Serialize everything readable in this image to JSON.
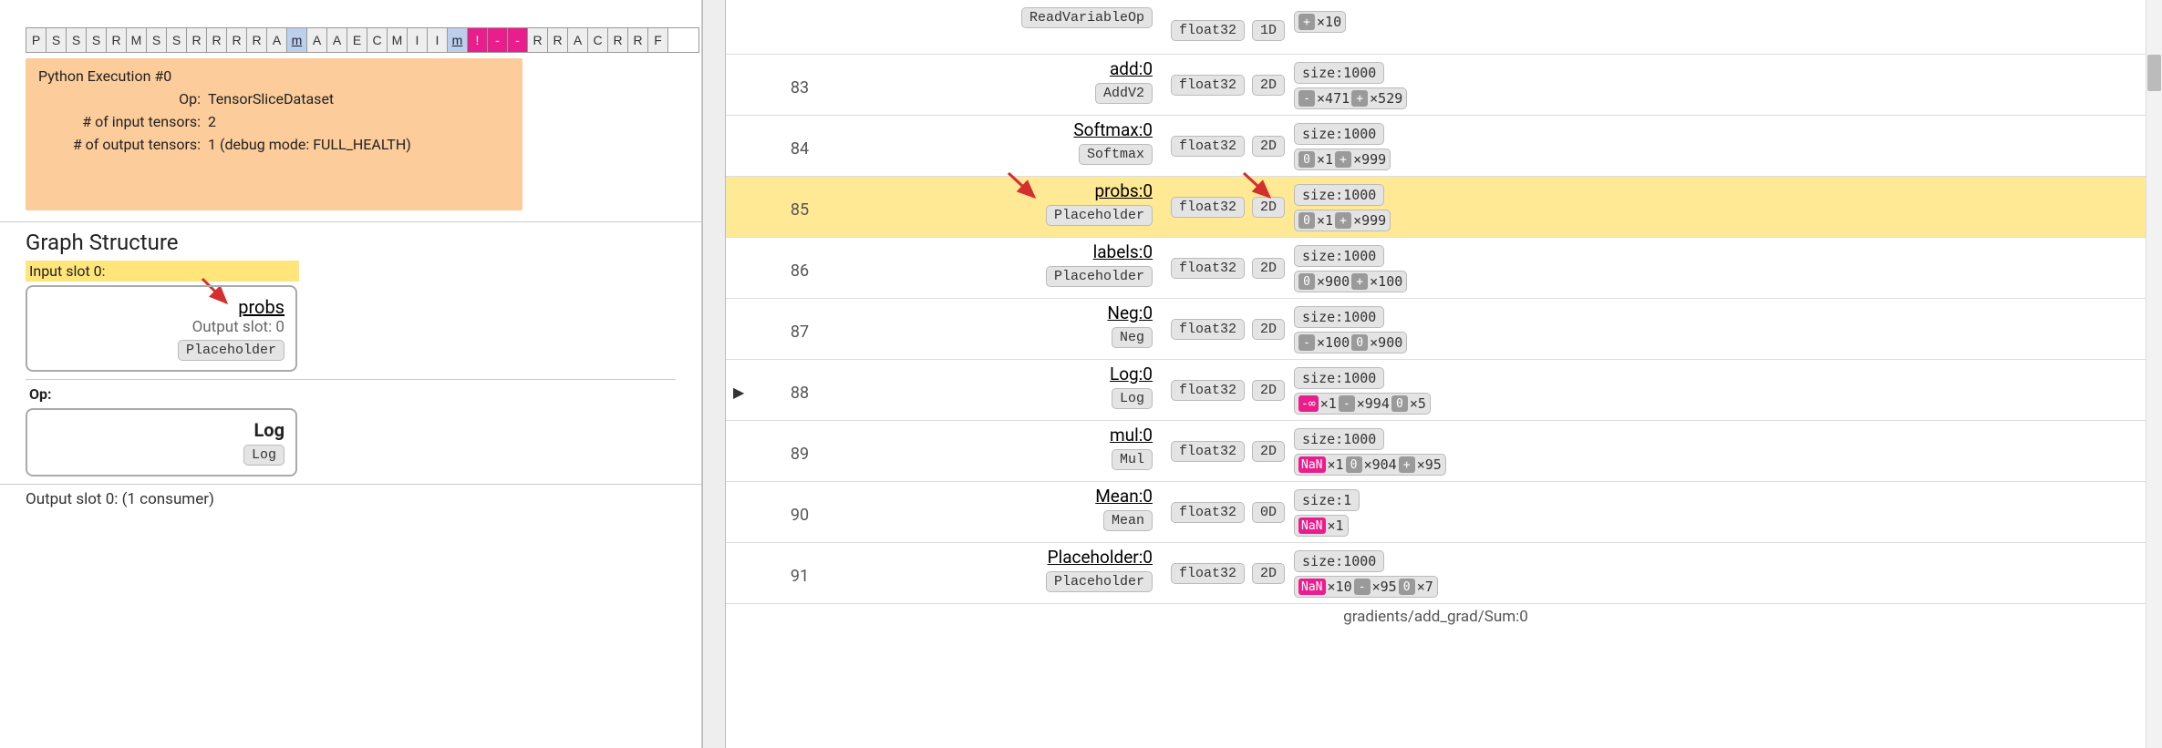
{
  "timeline": [
    {
      "l": "P"
    },
    {
      "l": "S"
    },
    {
      "l": "S"
    },
    {
      "l": "S"
    },
    {
      "l": "R"
    },
    {
      "l": "M"
    },
    {
      "l": "S"
    },
    {
      "l": "S"
    },
    {
      "l": "R"
    },
    {
      "l": "R"
    },
    {
      "l": "R"
    },
    {
      "l": "R"
    },
    {
      "l": "A"
    },
    {
      "l": "m",
      "cls": "bluebox",
      "link": true
    },
    {
      "l": "A"
    },
    {
      "l": "A"
    },
    {
      "l": "E"
    },
    {
      "l": "C"
    },
    {
      "l": "M"
    },
    {
      "l": "I"
    },
    {
      "l": "I"
    },
    {
      "l": "m",
      "cls": "bluebox",
      "link": true
    },
    {
      "l": "!",
      "cls": "magenta"
    },
    {
      "l": "-",
      "cls": "magenta"
    },
    {
      "l": "-",
      "cls": "magenta"
    },
    {
      "l": "R"
    },
    {
      "l": "R"
    },
    {
      "l": "A"
    },
    {
      "l": "C"
    },
    {
      "l": "R"
    },
    {
      "l": "R"
    },
    {
      "l": "F"
    }
  ],
  "detail": {
    "title": "Python Execution #0",
    "rows": [
      {
        "label": "Op:",
        "val": "TensorSliceDataset"
      },
      {
        "label": "# of input tensors:",
        "val": "2"
      },
      {
        "label": "# of output tensors:",
        "val": "1   (debug mode: FULL_HEALTH)"
      }
    ]
  },
  "graph_structure_title": "Graph Structure",
  "input_slot_label": "Input slot 0:",
  "probs_node": {
    "name": "probs",
    "sub": "Output slot: 0",
    "chip": "Placeholder"
  },
  "op_label": "Op:",
  "op_node": {
    "name": "Log",
    "chip": "Log"
  },
  "output_slot_text": "Output slot 0: (1 consumer)",
  "rows": [
    {
      "num": "",
      "name": "",
      "op": "ReadVariableOp",
      "dtype": "float32",
      "dim": "1D",
      "size": "",
      "counts": [
        {
          "t": "plus",
          "s": "+",
          "n": "×10"
        }
      ]
    },
    {
      "num": "83",
      "name": "add:0",
      "op": "AddV2",
      "dtype": "float32",
      "dim": "2D",
      "size": "size:1000",
      "counts": [
        {
          "t": "minus",
          "s": "-",
          "n": "×471"
        },
        {
          "t": "plus",
          "s": "+",
          "n": "×529"
        }
      ]
    },
    {
      "num": "84",
      "name": "Softmax:0",
      "op": "Softmax",
      "dtype": "float32",
      "dim": "2D",
      "size": "size:1000",
      "counts": [
        {
          "t": "zero",
          "s": "0",
          "n": "×1"
        },
        {
          "t": "plus",
          "s": "+",
          "n": "×999"
        }
      ]
    },
    {
      "num": "85",
      "name": "probs:0",
      "op": "Placeholder",
      "dtype": "float32",
      "dim": "2D",
      "size": "size:1000",
      "counts": [
        {
          "t": "zero",
          "s": "0",
          "n": "×1"
        },
        {
          "t": "plus",
          "s": "+",
          "n": "×999"
        }
      ],
      "highlight": true,
      "arrowLeft": true,
      "arrowRight": true
    },
    {
      "num": "86",
      "name": "labels:0",
      "op": "Placeholder",
      "dtype": "float32",
      "dim": "2D",
      "size": "size:1000",
      "counts": [
        {
          "t": "zero",
          "s": "0",
          "n": "×900"
        },
        {
          "t": "plus",
          "s": "+",
          "n": "×100"
        }
      ]
    },
    {
      "num": "87",
      "name": "Neg:0",
      "op": "Neg",
      "dtype": "float32",
      "dim": "2D",
      "size": "size:1000",
      "counts": [
        {
          "t": "minus",
          "s": "-",
          "n": "×100"
        },
        {
          "t": "zero",
          "s": "0",
          "n": "×900"
        }
      ]
    },
    {
      "num": "88",
      "name": "Log:0",
      "op": "Log",
      "dtype": "float32",
      "dim": "2D",
      "size": "size:1000",
      "counts": [
        {
          "t": "ninf",
          "s": "-∞",
          "n": "×1"
        },
        {
          "t": "minus",
          "s": "-",
          "n": "×994"
        },
        {
          "t": "zero",
          "s": "0",
          "n": "×5"
        }
      ],
      "expand": true
    },
    {
      "num": "89",
      "name": "mul:0",
      "op": "Mul",
      "dtype": "float32",
      "dim": "2D",
      "size": "size:1000",
      "counts": [
        {
          "t": "nan",
          "s": "NaN",
          "n": "×1"
        },
        {
          "t": "zero",
          "s": "0",
          "n": "×904"
        },
        {
          "t": "plus",
          "s": "+",
          "n": "×95"
        }
      ]
    },
    {
      "num": "90",
      "name": "Mean:0",
      "op": "Mean",
      "dtype": "float32",
      "dim": "0D",
      "size": "size:1",
      "counts": [
        {
          "t": "nan",
          "s": "NaN",
          "n": "×1"
        }
      ]
    },
    {
      "num": "91",
      "name": "Placeholder:0",
      "op": "Placeholder",
      "dtype": "float32",
      "dim": "2D",
      "size": "size:1000",
      "counts": [
        {
          "t": "nan",
          "s": "NaN",
          "n": "×10"
        },
        {
          "t": "minus",
          "s": "-",
          "n": "×95"
        },
        {
          "t": "zero",
          "s": "0",
          "n": "×7"
        }
      ]
    }
  ],
  "bottom_partial": "gradients/add_grad/Sum:0"
}
